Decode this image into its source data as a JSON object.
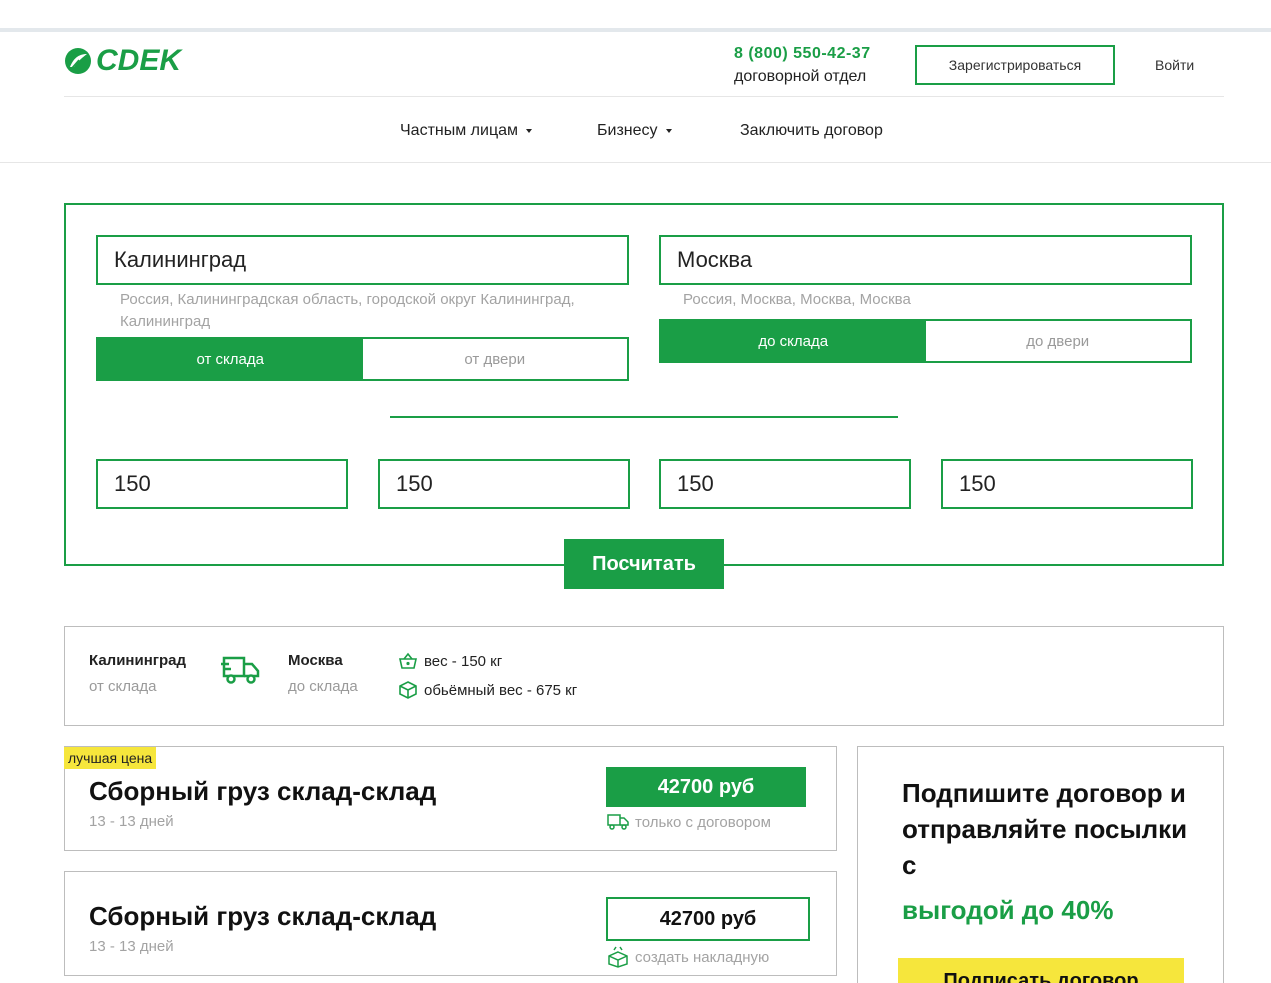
{
  "header": {
    "logo_text": "CDEK",
    "phone": "8 (800) 550-42-37",
    "phone_caption": "договорной отдел",
    "register_label": "Зарегистрироваться",
    "login_label": "Войти"
  },
  "nav": {
    "items": [
      {
        "label": "Частным лицам",
        "dropdown": true
      },
      {
        "label": "Бизнесу",
        "dropdown": true
      },
      {
        "label": "Заключить договор",
        "dropdown": false
      }
    ]
  },
  "calculator": {
    "from": {
      "city": "Калининград",
      "hint": "Россия, Калининградская область, городской округ Калининград, Калининград",
      "options": [
        "от склада",
        "от двери"
      ],
      "selected": "от склада"
    },
    "to": {
      "city": "Москва",
      "hint": "Россия, Москва, Москва, Москва",
      "options": [
        "до склада",
        "до двери"
      ],
      "selected": "до склада"
    },
    "dimensions": [
      "150",
      "150",
      "150",
      "150"
    ],
    "submit_label": "Посчитать"
  },
  "summary": {
    "from_city": "Калининград",
    "from_mode": "от склада",
    "to_city": "Москва",
    "to_mode": "до склада",
    "weight_label": "вес - 150  кг",
    "volume_label": "обьёмный вес -   675  кг"
  },
  "offers": [
    {
      "badge": "лучшая цена",
      "title": "Сборный груз склад-склад",
      "days": "13 - 13 дней",
      "price": "42700 руб",
      "note": "только с договором"
    },
    {
      "badge": "",
      "title": "Сборный груз склад-склад",
      "days": "13 - 13 дней",
      "price": "42700 руб",
      "note": "создать накладную"
    }
  ],
  "promo": {
    "title": "Подпишите договор и отправляйте посылки с",
    "accent": "выгодой до 40%",
    "button_label": "Подписать договор"
  },
  "colors": {
    "brand_green": "#1a9e46",
    "badge_yellow": "#f6e63c"
  }
}
